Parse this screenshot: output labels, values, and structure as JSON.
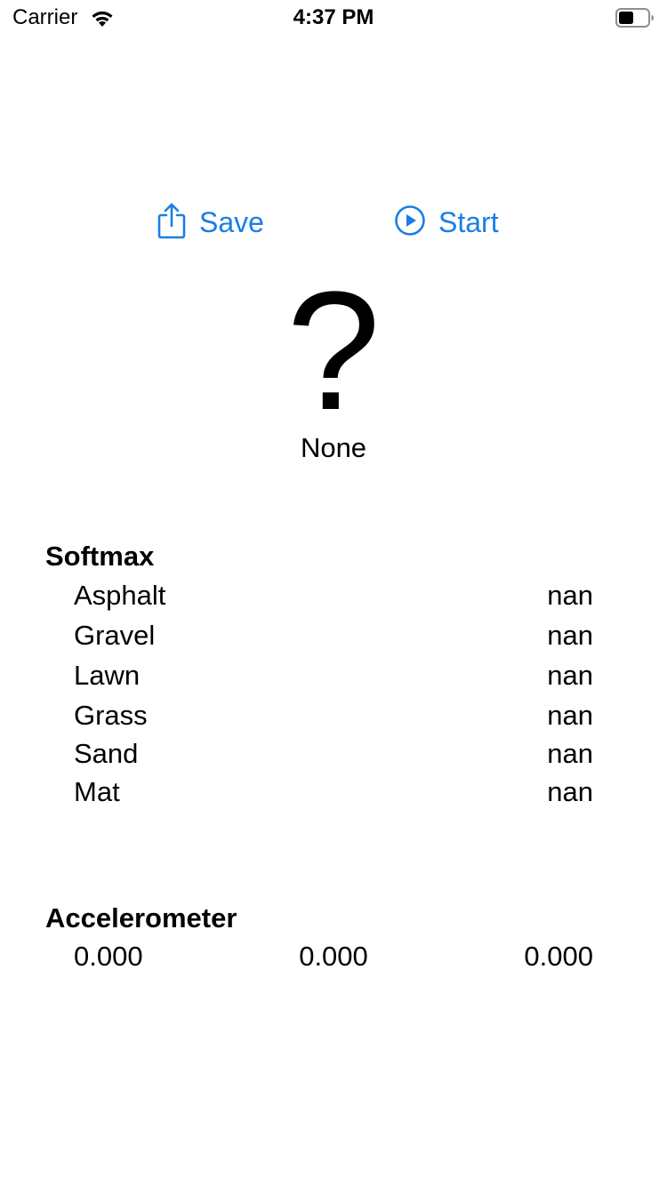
{
  "status_bar": {
    "carrier": "Carrier",
    "time": "4:37 PM",
    "wifi_icon": "wifi-icon",
    "battery_icon": "battery-icon"
  },
  "toolbar": {
    "save_label": "Save",
    "save_icon": "share-icon",
    "start_label": "Start",
    "start_icon": "play-circle-icon"
  },
  "prediction": {
    "symbol": "?",
    "label": "None"
  },
  "softmax": {
    "heading": "Softmax",
    "rows": [
      {
        "label": "Asphalt",
        "value": "nan"
      },
      {
        "label": "Gravel",
        "value": "nan"
      },
      {
        "label": "Lawn",
        "value": "nan"
      },
      {
        "label": "Grass",
        "value": "nan"
      },
      {
        "label": "Sand",
        "value": "nan"
      },
      {
        "label": "Mat",
        "value": "nan"
      }
    ]
  },
  "accelerometer": {
    "heading": "Accelerometer",
    "x": "0.000",
    "y": "0.000",
    "z": "0.000"
  },
  "colors": {
    "accent": "#1a7ee6",
    "text": "#000000",
    "background": "#ffffff"
  }
}
